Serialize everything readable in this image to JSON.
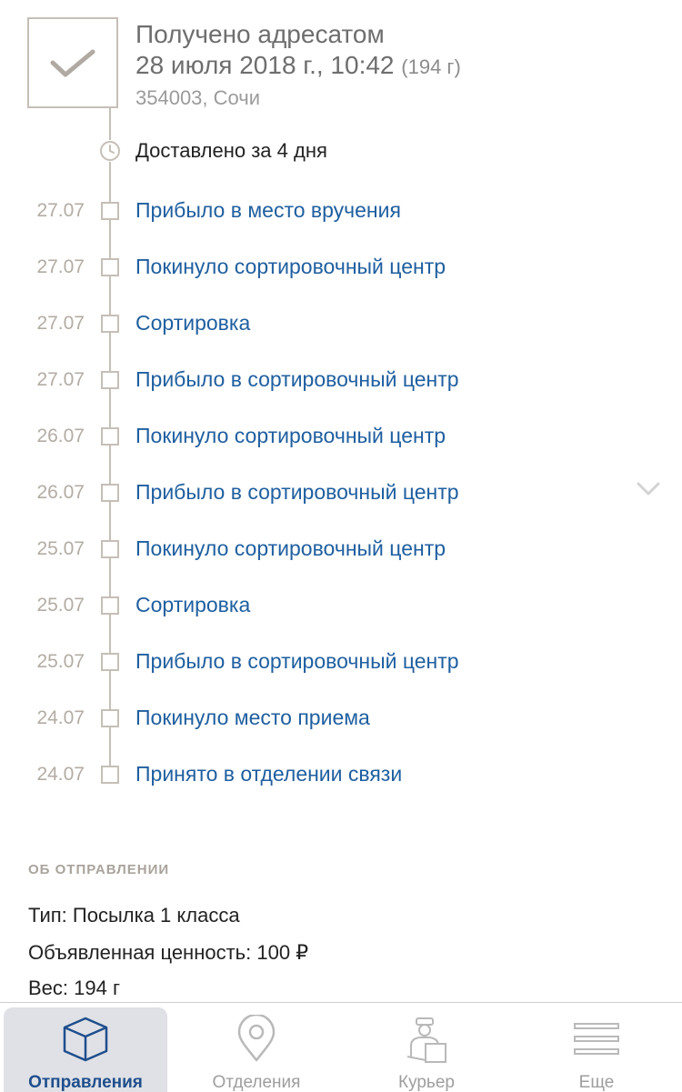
{
  "status": {
    "title": "Получено адресатом",
    "date": "28 июля 2018 г., 10:42",
    "weight": "(194 г)",
    "place": "354003, Сочи"
  },
  "delivered_label": "Доставлено за 4 дня",
  "events": [
    {
      "date": "27.07",
      "text": "Прибыло в место вручения"
    },
    {
      "date": "27.07",
      "text": "Покинуло сортировочный центр"
    },
    {
      "date": "27.07",
      "text": "Сортировка"
    },
    {
      "date": "27.07",
      "text": "Прибыло в сортировочный центр"
    },
    {
      "date": "26.07",
      "text": "Покинуло сортировочный центр"
    },
    {
      "date": "26.07",
      "text": "Прибыло в сортировочный центр"
    },
    {
      "date": "25.07",
      "text": "Покинуло сортировочный центр"
    },
    {
      "date": "25.07",
      "text": "Сортировка"
    },
    {
      "date": "25.07",
      "text": "Прибыло в сортировочный центр"
    },
    {
      "date": "24.07",
      "text": "Покинуло место приема"
    },
    {
      "date": "24.07",
      "text": "Принято в отделении связи"
    }
  ],
  "about": {
    "title": "ОБ ОТПРАВЛЕНИИ",
    "type": "Тип: Посылка 1 класса",
    "value": "Объявленная ценность: 100 ₽",
    "weight": "Вес: 194 г"
  },
  "tabs": [
    {
      "label": "Отправления",
      "icon": "parcel-box-icon",
      "active": true
    },
    {
      "label": "Отделения",
      "icon": "location-pin-icon",
      "active": false
    },
    {
      "label": "Курьер",
      "icon": "courier-icon",
      "active": false
    },
    {
      "label": "Еще",
      "icon": "menu-lines-icon",
      "active": false
    }
  ],
  "colors": {
    "link": "#1f5fa0",
    "accent": "#1f4e8c",
    "timeline": "#c5bfb6",
    "date_muted": "#b3aca3"
  }
}
